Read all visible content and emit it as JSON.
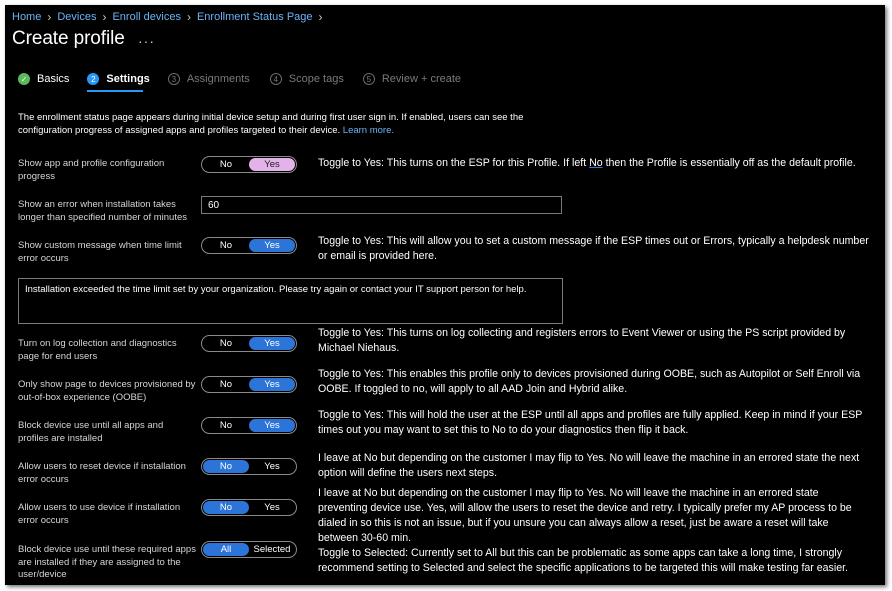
{
  "breadcrumb": [
    "Home",
    "Devices",
    "Enroll devices",
    "Enrollment Status Page"
  ],
  "page_title": "Create profile",
  "more_label": "···",
  "steps": [
    {
      "num": "✓",
      "label": "Basics",
      "state": "done"
    },
    {
      "num": "2",
      "label": "Settings",
      "state": "active"
    },
    {
      "num": "3",
      "label": "Assignments",
      "state": "todo"
    },
    {
      "num": "4",
      "label": "Scope tags",
      "state": "todo"
    },
    {
      "num": "5",
      "label": "Review + create",
      "state": "todo"
    }
  ],
  "intro": {
    "text": "The enrollment status page appears during initial device setup and during first user sign in. If enabled, users can see the configuration progress of assigned apps and profiles targeted to their device.",
    "link": "Learn more."
  },
  "settings": {
    "show_progress": {
      "label": "Show app and profile configuration progress",
      "off": "No",
      "on": "Yes",
      "value": "Yes"
    },
    "error_timeout": {
      "label": "Show an error when installation takes longer than specified number of minutes",
      "value": "60"
    },
    "custom_message": {
      "label": "Show custom message when time limit error occurs",
      "off": "No",
      "on": "Yes",
      "value": "Yes"
    },
    "message_text": "Installation exceeded the time limit set by your organization. Please try again or contact your IT support person for help.",
    "log_collection": {
      "label": "Turn on log collection and diagnostics page for end users",
      "off": "No",
      "on": "Yes",
      "value": "Yes"
    },
    "oobe_only": {
      "label": "Only show page to devices provisioned by out-of-box experience (OOBE)",
      "off": "No",
      "on": "Yes",
      "value": "Yes"
    },
    "block_until_installed": {
      "label": "Block device use until all apps and profiles are installed",
      "off": "No",
      "on": "Yes",
      "value": "Yes"
    },
    "allow_reset": {
      "label": "Allow users to reset device if installation error occurs",
      "off": "No",
      "on": "Yes",
      "value": "No"
    },
    "allow_use": {
      "label": "Allow users to use device if installation error occurs",
      "off": "No",
      "on": "Yes",
      "value": "No"
    },
    "block_required": {
      "label": "Block device use until these required apps are installed if they are assigned to the user/device",
      "off": "All",
      "on": "Selected",
      "value": "All"
    }
  },
  "notes": {
    "n1_pre": "Toggle to Yes: This turns on the ESP for this Profile. If left ",
    "n1_no": "No",
    "n1_post": " then the Profile is essentially off as the default profile.",
    "n2": "Toggle to Yes: This will allow you to set a custom message if the ESP times out or Errors, typically a helpdesk number or email is provided here.",
    "n3": "Toggle to Yes: This turns on log collecting and registers errors to Event Viewer or using the PS script provided by Michael Niehaus.",
    "n4": "Toggle to Yes: This enables this profile only to devices provisioned during OOBE, such as Autopilot or Self Enroll via OOBE. If toggled to no, will apply to all AAD Join and Hybrid alike.",
    "n5": "Toggle to Yes: This will hold the user at the ESP until all apps and profiles are fully applied. Keep in mind if your ESP times out you may want to set this to No to do your diagnostics then flip it back.",
    "n6": "I leave at No but depending on the customer I may flip to Yes. No will leave the machine in an errored state the next option will define the users next steps.",
    "n7": "I leave at No but depending on the customer I may flip to Yes. No will leave the machine in an errored state preventing device use. Yes, will allow the users to reset the device and retry. I typically prefer my AP process to be dialed in so this is not an issue, but if you unsure you can always allow a reset, just be aware a reset will take between 30-60 min.",
    "n8": "Toggle to Selected:  Currently set to All but this can be problematic as some apps can take a long time, I strongly recommend setting to Selected and select the specific applications to be targeted this will make testing far easier."
  },
  "colors": {
    "accent": "#2c74d8",
    "link": "#6cb3f5",
    "toggle_pink": "#e3b2e8",
    "success": "#5cb85c"
  }
}
